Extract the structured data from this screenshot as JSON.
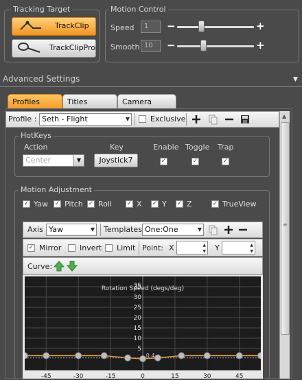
{
  "tracking_target": {
    "title": "Tracking Target",
    "trackclip_label": "TrackClip",
    "trackclippro_label": "TrackClipPro"
  },
  "motion_control": {
    "title": "Motion Control",
    "speed_label": "Speed",
    "speed_value": "1",
    "smooth_label": "Smooth",
    "smooth_value": "10",
    "speed_slider_fraction": 0.3,
    "smooth_slider_fraction": 0.33
  },
  "advanced": {
    "title": "Advanced Settings"
  },
  "tabs": [
    {
      "label": "Profiles",
      "active": true
    },
    {
      "label": "Titles",
      "active": false
    },
    {
      "label": "Camera",
      "active": false
    }
  ],
  "profile_bar": {
    "label": "Profile :",
    "selected": "Seth - Flight",
    "exclusive_label": "Exclusive",
    "exclusive_checked": false
  },
  "hotkeys": {
    "title": "HotKeys",
    "headers": {
      "action": "Action",
      "key": "Key",
      "enable": "Enable",
      "toggle": "Toggle",
      "trap": "Trap"
    },
    "action_value": "Center",
    "key_value": "Joystick7",
    "enable": true,
    "toggle": true,
    "trap": true
  },
  "motion_adjustment": {
    "title": "Motion Adjustment",
    "axes": [
      {
        "label": "Yaw",
        "checked": true
      },
      {
        "label": "Pitch",
        "checked": true
      },
      {
        "label": "Roll",
        "checked": true
      },
      {
        "label": "X",
        "checked": true
      },
      {
        "label": "Y",
        "checked": true
      },
      {
        "label": "Z",
        "checked": true
      },
      {
        "label": "TrueView",
        "checked": true
      }
    ]
  },
  "curve_editor": {
    "axis_label": "Axis",
    "axis_value": "Yaw",
    "templates_label": "Templates",
    "templates_value": "One:One",
    "mirror_label": "Mirror",
    "mirror_checked": true,
    "invert_label": "Invert",
    "invert_checked": false,
    "limit_label": "Limit",
    "limit_checked": false,
    "point_label": "Point:",
    "x_label": "X",
    "y_label": "Y",
    "x_value": "",
    "y_value": "",
    "curve_label": "Curve:"
  },
  "chart_data": {
    "type": "line",
    "title": "Rotation Speed (degs/deg)",
    "xlim": [
      -55,
      55
    ],
    "ylim": [
      0,
      40
    ],
    "x_ticks": [
      -45,
      -30,
      -15,
      0,
      15,
      30,
      45
    ],
    "y_ticks": [
      5,
      10,
      15,
      20,
      25,
      30,
      35
    ],
    "top_tick_label": "35",
    "annotation": "0.4",
    "grid": true,
    "series": [
      {
        "points": [
          [
            -55,
            1.5
          ],
          [
            -45,
            1.5
          ],
          [
            -30,
            1.5
          ],
          [
            -18,
            1.5
          ],
          [
            -7,
            0.4
          ],
          [
            0,
            0
          ],
          [
            7,
            0.4
          ],
          [
            18,
            1.5
          ],
          [
            30,
            1.5
          ],
          [
            45,
            1.5
          ],
          [
            55,
            1.5
          ]
        ],
        "handles_x": [
          -55,
          -45,
          -30,
          -18,
          -7,
          0,
          7,
          18,
          30,
          45,
          55
        ]
      }
    ],
    "colors": {
      "curve": "#e8a040",
      "handle": "#bdbdbd",
      "grid": "#4a4a4a",
      "background": "#1c1c1c"
    }
  }
}
